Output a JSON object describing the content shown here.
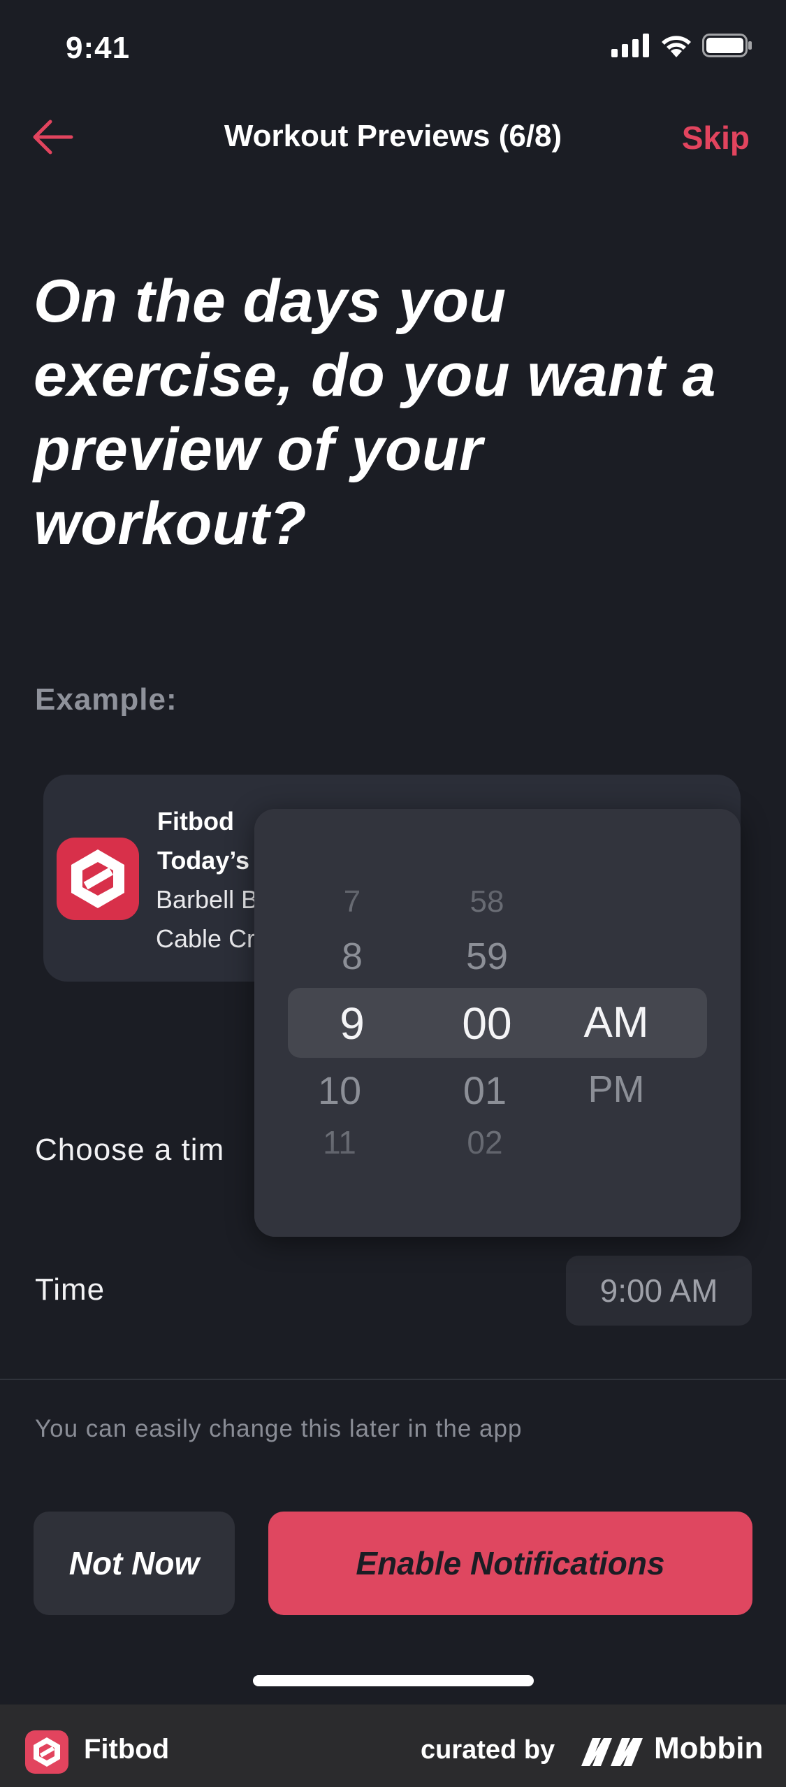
{
  "status_bar": {
    "time": "9:41"
  },
  "nav": {
    "title": "Workout Previews (6/8)",
    "skip_label": "Skip"
  },
  "headline": "On the days you exercise, do you want a preview of your workout?",
  "example_label": "Example:",
  "notification": {
    "app": "Fitbod",
    "title": "Today’s ’",
    "line1": "Barbell B",
    "line2": "Cable Cr"
  },
  "choose_label": "Choose a tim",
  "picker": {
    "hours": [
      "7",
      "8",
      "9",
      "10",
      "11"
    ],
    "minutes": [
      "58",
      "59",
      "00",
      "01",
      "02"
    ],
    "periods": [
      "AM",
      "PM"
    ],
    "selected": {
      "hour": "9",
      "minute": "00",
      "period": "AM"
    }
  },
  "time_row": {
    "label": "Time",
    "value": "9:00 AM"
  },
  "hint": "You can easily change this later in the app",
  "buttons": {
    "not_now": "Not Now",
    "enable": "Enable Notifications"
  },
  "footer": {
    "app_name": "Fitbod",
    "curated_by": "curated by",
    "brand": "Mobbin"
  },
  "colors": {
    "accent": "#e2445e",
    "background": "#1b1d24",
    "button_primary": "#df4760"
  },
  "icons": {
    "back": "arrow-left-icon",
    "signal": "cellular-signal-icon",
    "wifi": "wifi-icon",
    "battery": "battery-icon",
    "app_logo": "fitbod-logo-icon",
    "brand_logo": "mobbin-logo-icon"
  }
}
